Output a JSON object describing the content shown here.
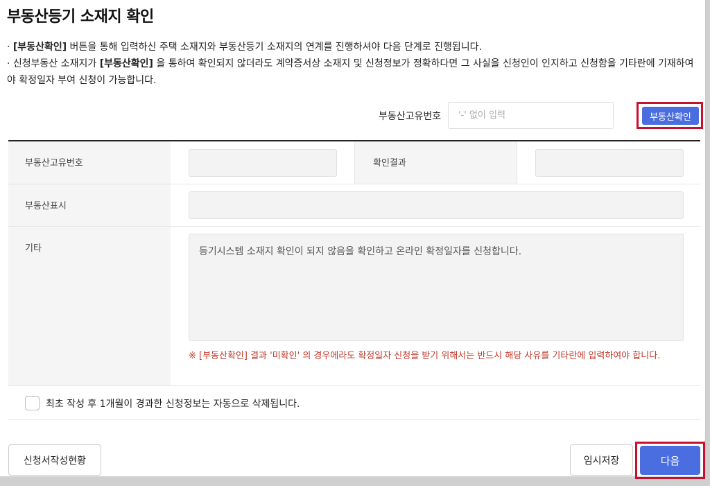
{
  "title": "부동산등기 소재지 확인",
  "notes": {
    "line1_prefix": "· ",
    "line1_bold": "[부동산확인]",
    "line1_rest": "  버튼을 통해 입력하신 주택 소재지와 부동산등기 소재지의 연계를 진행하셔야 다음 단계로 진행됩니다.",
    "line2_prefix": "· 신청부동산 소재지가 ",
    "line2_bold": "[부동산확인]",
    "line2_rest": " 을 통하여 확인되지 않더라도 계약증서상 소재지 및 신청정보가 정확하다면 그 사실을 신청인이 인지하고 신청함을 기타란에 기재하여야 확정일자 부여 신청이 가능합니다."
  },
  "search": {
    "label": "부동산고유번호",
    "placeholder": "'-' 없이 입력",
    "button": "부동산확인"
  },
  "table": {
    "unique_no_label": "부동산고유번호",
    "result_label": "확인결과",
    "display_label": "부동산표시",
    "etc_label": "기타",
    "etc_value": "등기시스템 소재지 확인이 되지 않음을 확인하고 온라인 확정일자를 신청합니다.",
    "warning": "※ [부동산확인] 결과 '미확인' 의 경우에라도 확정일자 신청을 받기 위해서는 반드시 해당 사유를 기타란에 입력하여야 합니다."
  },
  "checkbox_label": "최초 작성 후 1개월이 경과한 신청정보는 자동으로 삭제됩니다.",
  "buttons": {
    "status": "신청서작성현황",
    "temp_save": "임시저장",
    "next": "다음"
  }
}
